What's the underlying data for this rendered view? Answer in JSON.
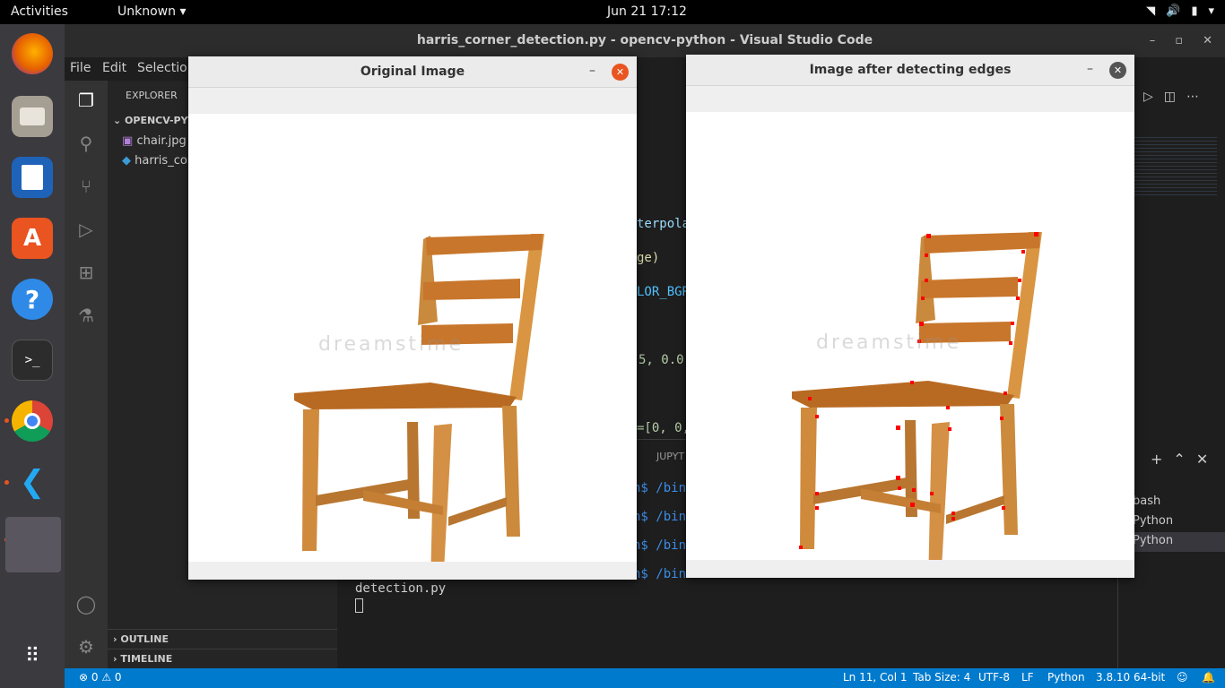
{
  "topbar": {
    "activities": "Activities",
    "app_menu": "Unknown ▾",
    "clock": "Jun 21  17:12"
  },
  "dock": {
    "items": [
      "firefox-icon",
      "files-icon",
      "writer-icon",
      "software-icon",
      "help-icon",
      "terminal-icon",
      "chrome-icon",
      "vscode-icon",
      "show-apps-icon"
    ]
  },
  "vscode": {
    "title": "harris_corner_detection.py - opencv-python - Visual Studio Code",
    "menu": [
      "File",
      "Edit",
      "Selectio"
    ],
    "explorer": {
      "header": "EXPLORER",
      "folder": "OPENCV-PYT",
      "files": [
        "chair.jpg",
        "harris_cor"
      ],
      "outline": "OUTLINE",
      "timeline": "TIMELINE"
    },
    "code_fragments": [
      "terpola",
      "ge)",
      "LOR_BGR",
      "5, 0.0",
      "=[0, 0,"
    ],
    "panel": {
      "tab_fragment": "JUPYT",
      "prompts": [
        "n$ /bin",
        "n$ /bin",
        "n$ /bin",
        "n$ /bin"
      ],
      "line_cont": "detection.py"
    },
    "terminals": [
      "bash",
      "Python",
      "Python"
    ],
    "status": {
      "errors": "⊗ 0 ⚠ 0",
      "position": "Ln 11, Col 1",
      "tab_size": "Tab Size: 4",
      "encoding": "UTF-8",
      "eol": "LF",
      "language": "Python",
      "interpreter": "3.8.10 64-bit"
    }
  },
  "win_original": {
    "title": "Original Image"
  },
  "win_edges": {
    "title": "Image after detecting edges"
  },
  "watermark": "dreamstime",
  "colors": {
    "accent": "#007acc",
    "close": "#e95420",
    "corner": "#ff0000"
  }
}
